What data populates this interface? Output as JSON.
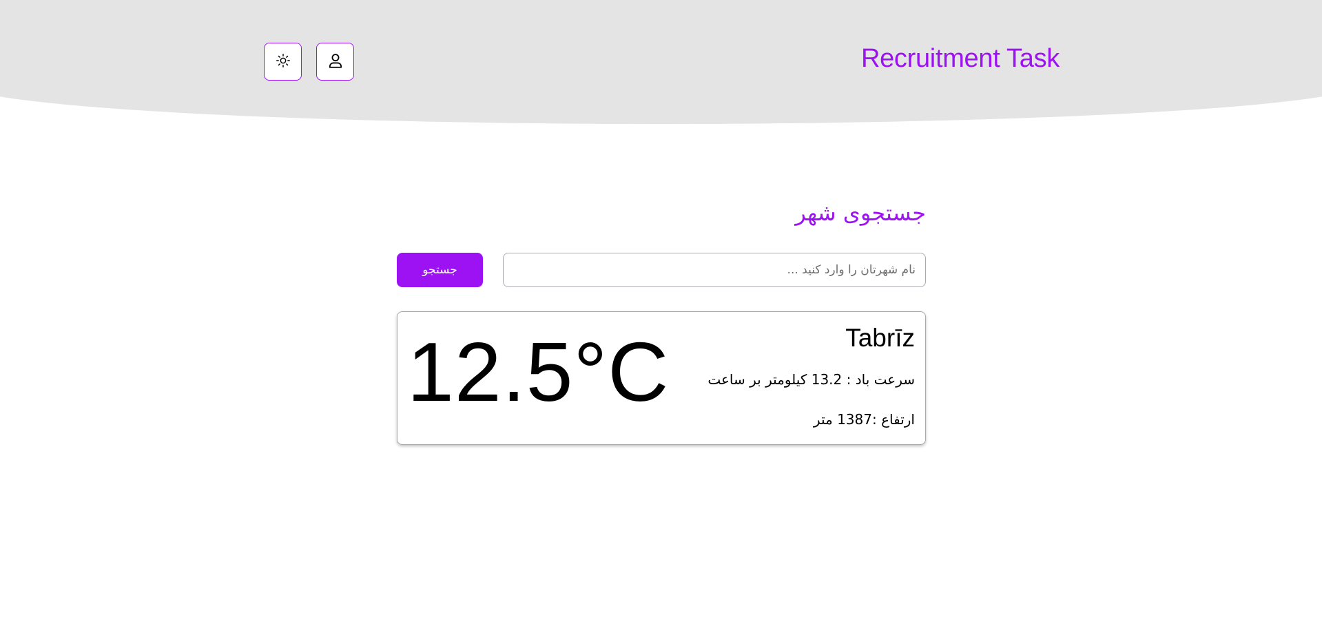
{
  "header": {
    "brand_title": "Recruitment Task",
    "theme_toggle_icon": "sun-icon",
    "profile_icon": "user-icon",
    "background_color": "#e4e4e5",
    "accent_color": "#9d12f2"
  },
  "search": {
    "title": "جستجوی شهر",
    "placeholder": "نام شهرتان را وارد کنید ...",
    "value": "",
    "button_label": "جستجو"
  },
  "weather_card": {
    "city": "Tabrīz",
    "temperature": "12.5°C",
    "wind_speed": "سرعت باد : 13.2 کیلومتر بر ساعت",
    "elevation": "ارتفاع :1387 متر"
  }
}
